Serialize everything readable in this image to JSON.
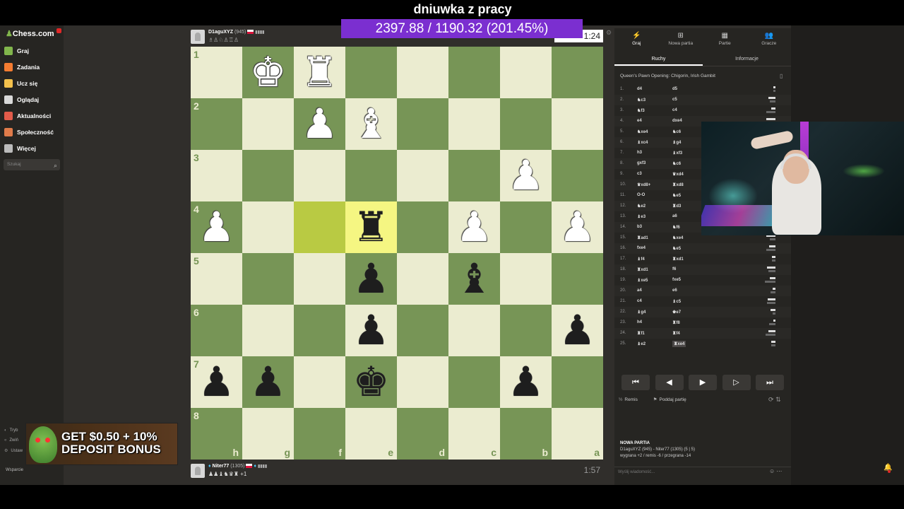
{
  "stream": {
    "title": "dniuwka z pracy",
    "counter": "2397.88 / 1190.32 (201.45%)"
  },
  "sidebar": {
    "logo": "Chess.com",
    "items": [
      {
        "label": "Graj",
        "icon": "play-icon",
        "color": "#81b64c"
      },
      {
        "label": "Zadania",
        "icon": "puzzle-icon",
        "color": "#f47c31"
      },
      {
        "label": "Ucz się",
        "icon": "learn-icon",
        "color": "#f4c14c"
      },
      {
        "label": "Oglądaj",
        "icon": "watch-icon",
        "color": "#d9d9d9"
      },
      {
        "label": "Aktualności",
        "icon": "news-icon",
        "color": "#e25b4a"
      },
      {
        "label": "Społeczność",
        "icon": "community-icon",
        "color": "#e07b4a"
      },
      {
        "label": "Więcej",
        "icon": "more-icon",
        "color": "#bbbbbb"
      }
    ],
    "search_placeholder": "Szukaj",
    "bottom": [
      "Tryb",
      "Zwiń",
      "Ustaw"
    ],
    "support": "Wsparcie"
  },
  "ad": {
    "text_line1": "GET $0.50 + 10%",
    "text_line2": "DEPOSIT BONUS"
  },
  "top_player": {
    "name": "D1aguXYZ",
    "rating": "(945)",
    "captured": "♗♙♘♙♖♙",
    "clock": "1:24"
  },
  "bottom_player": {
    "name": "Niter77",
    "rating": "(1305)",
    "captured": "♟♟♝♞♛♜ +1",
    "clock": "1:57"
  },
  "board": {
    "ranks": [
      "1",
      "2",
      "3",
      "4",
      "5",
      "6",
      "7",
      "8"
    ],
    "files": [
      "h",
      "g",
      "f",
      "e",
      "d",
      "c",
      "b",
      "a"
    ],
    "highlight": [
      "4-2",
      "4-3"
    ],
    "pieces": [
      {
        "r": 0,
        "c": 1,
        "p": "♚",
        "side": "w"
      },
      {
        "r": 0,
        "c": 2,
        "p": "♜",
        "side": "w"
      },
      {
        "r": 1,
        "c": 2,
        "p": "♟",
        "side": "w"
      },
      {
        "r": 1,
        "c": 3,
        "p": "♝",
        "side": "w"
      },
      {
        "r": 2,
        "c": 6,
        "p": "♟",
        "side": "w"
      },
      {
        "r": 3,
        "c": 0,
        "p": "♟",
        "side": "w"
      },
      {
        "r": 3,
        "c": 3,
        "p": "♜",
        "side": "b"
      },
      {
        "r": 3,
        "c": 5,
        "p": "♟",
        "side": "w"
      },
      {
        "r": 3,
        "c": 7,
        "p": "♟",
        "side": "w"
      },
      {
        "r": 4,
        "c": 3,
        "p": "♟",
        "side": "b"
      },
      {
        "r": 4,
        "c": 5,
        "p": "♝",
        "side": "b"
      },
      {
        "r": 5,
        "c": 3,
        "p": "♟",
        "side": "b"
      },
      {
        "r": 5,
        "c": 7,
        "p": "♟",
        "side": "b"
      },
      {
        "r": 6,
        "c": 0,
        "p": "♟",
        "side": "b"
      },
      {
        "r": 6,
        "c": 1,
        "p": "♟",
        "side": "b"
      },
      {
        "r": 6,
        "c": 3,
        "p": "♚",
        "side": "b"
      },
      {
        "r": 6,
        "c": 6,
        "p": "♟",
        "side": "b"
      }
    ]
  },
  "panel": {
    "tabs": [
      {
        "label": "Graj",
        "icon": "⚡"
      },
      {
        "label": "Nowa partia",
        "icon": "⊞"
      },
      {
        "label": "Partie",
        "icon": "▦"
      },
      {
        "label": "Gracze",
        "icon": "👥"
      }
    ],
    "subtabs": [
      "Ruchy",
      "Informacje"
    ],
    "opening": "Queen's Pawn Opening: Chigorin, Irish Gambit",
    "moves": [
      [
        "1.",
        "d4",
        "d5"
      ],
      [
        "2.",
        "♞c3",
        "c5"
      ],
      [
        "3.",
        "♞f3",
        "c4"
      ],
      [
        "4.",
        "e4",
        "dxe4"
      ],
      [
        "5.",
        "♞xe4",
        "♞c6"
      ],
      [
        "6.",
        "♝xc4",
        "♝g4"
      ],
      [
        "7.",
        "h3",
        "♝xf3"
      ],
      [
        "8.",
        "gxf3",
        "♞c6"
      ],
      [
        "9.",
        "c3",
        "♛xd4"
      ],
      [
        "10.",
        "♛xd8+",
        "♜xd8"
      ],
      [
        "11.",
        "O-O",
        "♞e5"
      ],
      [
        "12.",
        "♞e2",
        "♜d3"
      ],
      [
        "13.",
        "♝e3",
        "a6"
      ],
      [
        "14.",
        "b3",
        "♞f6"
      ],
      [
        "15.",
        "♜ad1",
        "♞xe4"
      ],
      [
        "16.",
        "fxe4",
        "♞e5"
      ],
      [
        "17.",
        "♝f4",
        "♜xd1"
      ],
      [
        "18.",
        "♜xd1",
        "f6"
      ],
      [
        "19.",
        "♝xe5",
        "fxe5"
      ],
      [
        "20.",
        "a4",
        "e6"
      ],
      [
        "21.",
        "c4",
        "♝c5"
      ],
      [
        "22.",
        "♝g4",
        "♚e7"
      ],
      [
        "23.",
        "h4",
        "♜f8"
      ],
      [
        "24.",
        "♜f1",
        "♜f4"
      ],
      [
        "25.",
        "♝e2",
        "♜xe4"
      ]
    ],
    "controls": [
      "⏮",
      "◀",
      "▶",
      "▷",
      "⏭"
    ],
    "draw": "Remis",
    "resign": "Poddaj partię",
    "new_game_title": "NOWA PARTIA",
    "new_game_line1": "D1aguXYZ (945) - Niter77 (1305) (5 | 5)",
    "new_game_line2": "wygrana +2 / remis -6 / przegrana -14",
    "chat_placeholder": "Wyślij wiadomość..."
  }
}
